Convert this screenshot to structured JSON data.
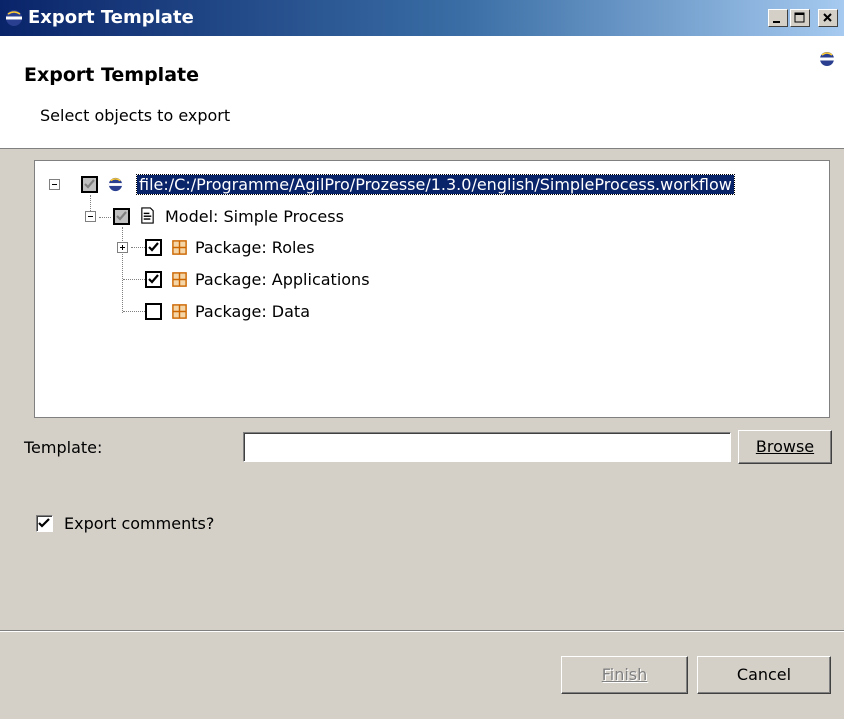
{
  "window": {
    "title": "Export Template"
  },
  "banner": {
    "heading": "Export Template",
    "description": "Select objects to export"
  },
  "tree": {
    "root": {
      "label": "file:/C:/Programme/AgilPro/Prozesse/1.3.0/english/SimpleProcess.workflow",
      "checked": true,
      "grayed": true,
      "selected": true
    },
    "model": {
      "label": "Model: Simple Process",
      "checked": true,
      "grayed": true
    },
    "packages": [
      {
        "label": "Package: Roles",
        "checked": true,
        "expandable": true
      },
      {
        "label": "Package: Applications",
        "checked": true,
        "expandable": false
      },
      {
        "label": "Package: Data",
        "checked": false,
        "expandable": false
      }
    ]
  },
  "template": {
    "label": "Template:",
    "value": "",
    "browse_label": "Browse"
  },
  "options": {
    "export_comments_label": "Export comments?",
    "export_comments_checked": true
  },
  "buttons": {
    "finish_label": "Finish",
    "cancel_label": "Cancel",
    "finish_enabled": false
  },
  "colors": {
    "title_bar": "#0a246a",
    "selection": "#0a246a",
    "dialog_bg": "#d4d0c8",
    "package_icon": "#cc6600"
  }
}
